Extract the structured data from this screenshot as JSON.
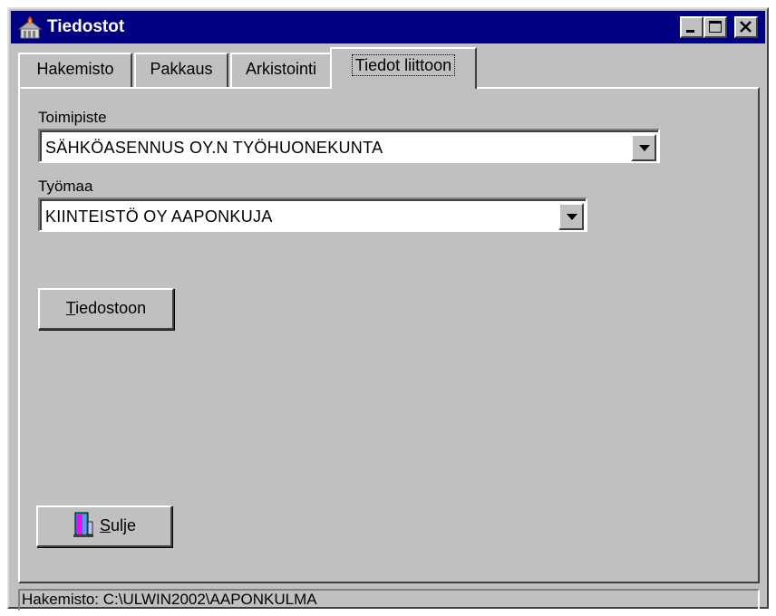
{
  "window": {
    "title": "Tiedostot",
    "controls": {
      "minimize": "minimize-icon",
      "maximize": "maximize-icon",
      "close": "close-icon"
    }
  },
  "tabs": [
    {
      "label": "Hakemisto",
      "active": false
    },
    {
      "label": "Pakkaus",
      "active": false
    },
    {
      "label": "Arkistointi",
      "active": false
    },
    {
      "label": "Tiedot liittoon",
      "active": true
    }
  ],
  "form": {
    "toimipiste_label": "Toimipiste",
    "toimipiste_value": "SÄHKÖASENNUS OY.N TYÖHUONEKUNTA",
    "tyomaa_label": "Työmaa",
    "tyomaa_value": "KIINTEISTÖ OY AAPONKUJA",
    "tiedostoon_button": {
      "mnemonic": "T",
      "rest": "iedostoon"
    }
  },
  "footer": {
    "close_button": {
      "mnemonic": "S",
      "rest": "ulje",
      "icon": "exit-door-icon"
    },
    "status_text": "Hakemisto: C:\\ULWIN2002\\AAPONKULMA"
  }
}
